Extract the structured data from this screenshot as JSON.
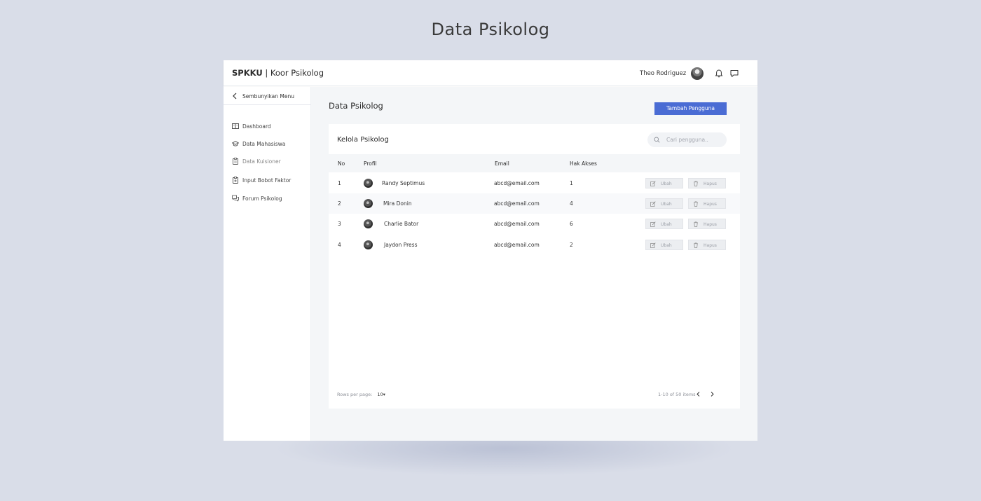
{
  "page_heading": "Data Psikolog",
  "topbar": {
    "brand_bold": "SPKKU",
    "brand_rest": " | Koor Psikolog",
    "username": "Theo Rodriguez"
  },
  "sidebar": {
    "hide_menu": "Sembunyikan Menu",
    "items": [
      {
        "label": "Dashboard",
        "icon": "book-icon"
      },
      {
        "label": "Data Mahasiswa",
        "icon": "graduation-cap-icon"
      },
      {
        "label": "Data Kuisioner",
        "icon": "clipboard-icon"
      },
      {
        "label": "Input Bobot Faktor",
        "icon": "clipboard-plus-icon"
      },
      {
        "label": "Forum Psikolog",
        "icon": "chat-bubbles-icon"
      }
    ]
  },
  "main": {
    "title": "Data Psikolog",
    "add_button": "Tambah Pengguna"
  },
  "card": {
    "title": "Kelola Psikolog",
    "search_placeholder": "Cari pengguna..",
    "columns": {
      "no": "No",
      "profil": "Profil",
      "email": "Email",
      "hak_akses": "Hak Akses"
    },
    "rows": [
      {
        "no": "1",
        "name": "Randy Septimus",
        "email": "abcd@email.com",
        "hak_akses": "1"
      },
      {
        "no": "2",
        "name": "Mira Donin",
        "email": "abcd@email.com",
        "hak_akses": "4"
      },
      {
        "no": "3",
        "name": "Charlie Bator",
        "email": "abcd@email.com",
        "hak_akses": "6"
      },
      {
        "no": "4",
        "name": "Jaydon Press",
        "email": "abcd@email.com",
        "hak_akses": "2"
      }
    ],
    "edit_label": "Ubah",
    "delete_label": "Hapus",
    "rows_per_page_label": "Rows per page:",
    "rows_per_page_value": "10",
    "range_text": "1-10 of 50 items"
  },
  "colors": {
    "background": "#d9dde8",
    "accent": "#4a6cd4",
    "content_bg": "#f4f6f8"
  }
}
